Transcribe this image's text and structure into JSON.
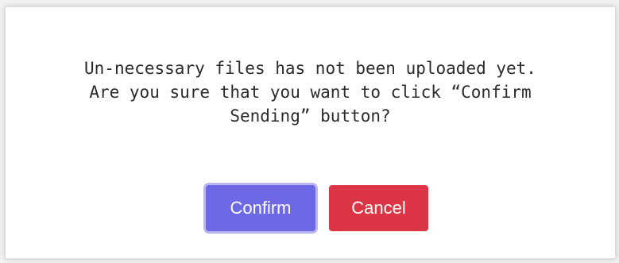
{
  "dialog": {
    "message_lines": [
      "Un-necessary files has not been uploaded yet.",
      "Are you sure that you want to click “Confirm",
      "Sending” button?"
    ],
    "confirm_label": "Confirm",
    "cancel_label": "Cancel"
  },
  "colors": {
    "confirm": "#6d68e5",
    "cancel": "#dc3545"
  }
}
